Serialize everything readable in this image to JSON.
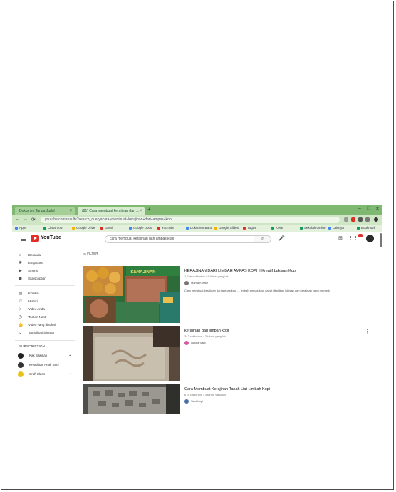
{
  "browser": {
    "tabs": [
      {
        "label": "Dokumen Tanpa Judul"
      },
      {
        "label": "(81) Cara membuat kerajinan dari ..."
      }
    ],
    "new_tab": "+",
    "window_controls": [
      "–",
      "□",
      "✕"
    ],
    "url": "youtube.com/results?search_query=cara+membuat+kerajinan+dari+ampas+kopi",
    "nav": [
      "←",
      "→",
      "⟳"
    ],
    "bookmarks": [
      {
        "label": "Apps",
        "color": "#4285f4"
      },
      {
        "label": "Classroom",
        "color": "#0f9d58"
      },
      {
        "label": "Google Drive",
        "color": "#f4b400"
      },
      {
        "label": "Gmail",
        "color": "#d93025"
      },
      {
        "label": "Google Docs",
        "color": "#4285f4"
      },
      {
        "label": "YouTube",
        "color": "#e52d27"
      },
      {
        "label": "Dokumen Baru",
        "color": "#4285f4"
      },
      {
        "label": "Google Slides",
        "color": "#f4b400"
      },
      {
        "label": "Tugas",
        "color": "#e52d27"
      },
      {
        "label": "Kelas",
        "color": "#0f9d58"
      },
      {
        "label": "Sekolah Online",
        "color": "#0f9d58"
      },
      {
        "label": "Lainnya",
        "color": "#4285f4"
      },
      {
        "label": "Bookmark",
        "color": "#0f9d58"
      }
    ]
  },
  "youtube": {
    "brand": "YouTube",
    "search_query": "cara membuat kerajinan dari ampas kopi",
    "sidebar": {
      "items": [
        {
          "icon": "⌂",
          "label": "Beranda"
        },
        {
          "icon": "✺",
          "label": "Eksplorasi"
        },
        {
          "icon": "▶",
          "label": "Shorts"
        },
        {
          "icon": "▣",
          "label": "Subscription"
        }
      ],
      "items2": [
        {
          "icon": "▤",
          "label": "Koleksi"
        },
        {
          "icon": "↺",
          "label": "Histori"
        },
        {
          "icon": "▷",
          "label": "Video Anda"
        },
        {
          "icon": "◷",
          "label": "Tonton Nanti"
        },
        {
          "icon": "👍",
          "label": "Video yang disukai"
        },
        {
          "icon": "⌄",
          "label": "Tampilkan lainnya"
        }
      ],
      "subscriptions_heading": "SUBSCRIPTION",
      "subscriptions": [
        {
          "name": "Kak Sakinah",
          "color": "#222222"
        },
        {
          "name": "Kreatifitas Anak Seni",
          "color": "#333333"
        },
        {
          "name": "Craft Ideas",
          "color": "#e8c21a"
        }
      ]
    },
    "filters_label": "FILTER",
    "results": [
      {
        "title": "KERAJINAN DARI LIMBAH AMPAS KOPI || Kreatif Lukisan Kopi",
        "meta": "1,2 rb x ditonton • 1 tahun yang lalu",
        "channel": "Mama Kreatif",
        "channel_color": "#777777",
        "desc": "Cara membuat kerajinan dari ampas kopi ... limbah ampas kopi dapat dijadikan lukisan dan kerajinan yang menarik."
      },
      {
        "title": "kerajinan dari limbah kopi",
        "meta": "342 x ditonton • 2 tahun yang lalu",
        "channel": "Nabila Sani",
        "channel_color": "#d45aa0",
        "desc": ""
      },
      {
        "title": "Cara Membuat Kerajinan Tanah Liat Limbah Kopi",
        "meta": "878 x ditonton • 3 tahun yang lalu",
        "channel": "Seni Kopi",
        "channel_color": "#4a6fa5",
        "desc": ""
      }
    ]
  }
}
